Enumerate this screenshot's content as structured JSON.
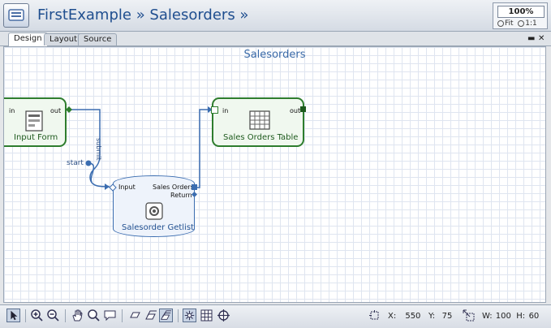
{
  "window": {
    "title": "FirstExample » Salesorders »"
  },
  "zoom": {
    "value": "100%",
    "fit_label": "Fit",
    "one_label": "1:1"
  },
  "tabs": [
    {
      "label": "Design",
      "active": true
    },
    {
      "label": "Layout"
    },
    {
      "label": "Source"
    }
  ],
  "window_controls": {
    "restore": "▬",
    "close": "✕"
  },
  "diagram": {
    "title": "Salesorders",
    "nodes": [
      {
        "label": "Input Form",
        "icon": "form-icon",
        "ports": {
          "in": "in",
          "out": "out"
        }
      },
      {
        "label": "Sales Orders Table",
        "icon": "table-icon",
        "ports": {
          "in": "in",
          "out": "out"
        }
      },
      {
        "label": "Salesorder Getlist",
        "icon": "service-icon",
        "ports": {
          "input": "Input",
          "sales_orders": "Sales Orders",
          "return": "Return"
        }
      }
    ],
    "edges": {
      "submit": "submit",
      "start": "start"
    }
  },
  "status": {
    "x_label": "X:",
    "x": "550",
    "y_label": "Y:",
    "y": "75",
    "w_label": "W:",
    "w": "100",
    "h_label": "H:",
    "h": "60"
  },
  "colors": {
    "accent": "#3b6db0",
    "green": "#2e7d2e",
    "title": "#1f4e8f"
  }
}
